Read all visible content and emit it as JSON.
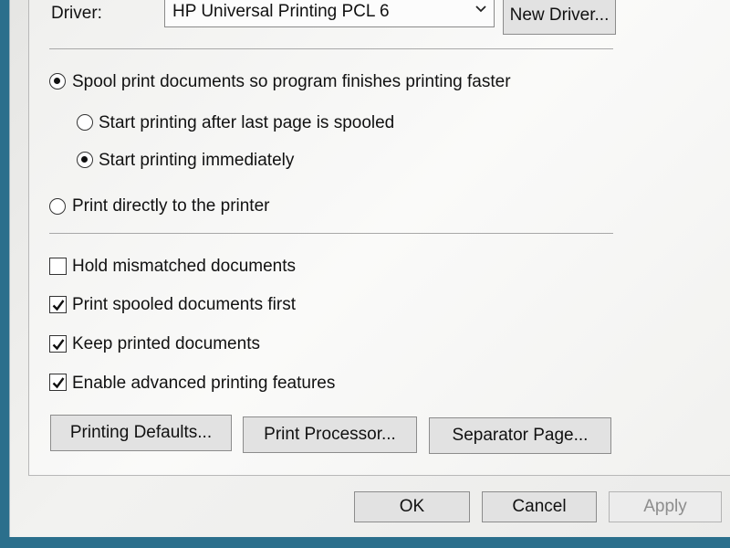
{
  "driver": {
    "label": "Driver:",
    "selected": "HP Universal Printing PCL 6",
    "new_driver_button": "New Driver..."
  },
  "spooling": {
    "spool_option": "Spool print documents so program finishes printing faster",
    "spool_selected": true,
    "sub_options": [
      {
        "label": "Start printing after last page is spooled",
        "selected": false
      },
      {
        "label": "Start printing immediately",
        "selected": true
      }
    ],
    "direct_option": "Print directly to the printer",
    "direct_selected": false
  },
  "checkboxes": [
    {
      "label": "Hold mismatched documents",
      "checked": false
    },
    {
      "label": "Print spooled documents first",
      "checked": true
    },
    {
      "label": "Keep printed documents",
      "checked": true
    },
    {
      "label": "Enable advanced printing features",
      "checked": true
    }
  ],
  "panel_buttons": {
    "printing_defaults": "Printing Defaults...",
    "print_processor": "Print Processor...",
    "separator_page": "Separator Page..."
  },
  "dialog_buttons": {
    "ok": "OK",
    "cancel": "Cancel",
    "apply": "Apply",
    "apply_enabled": false
  }
}
